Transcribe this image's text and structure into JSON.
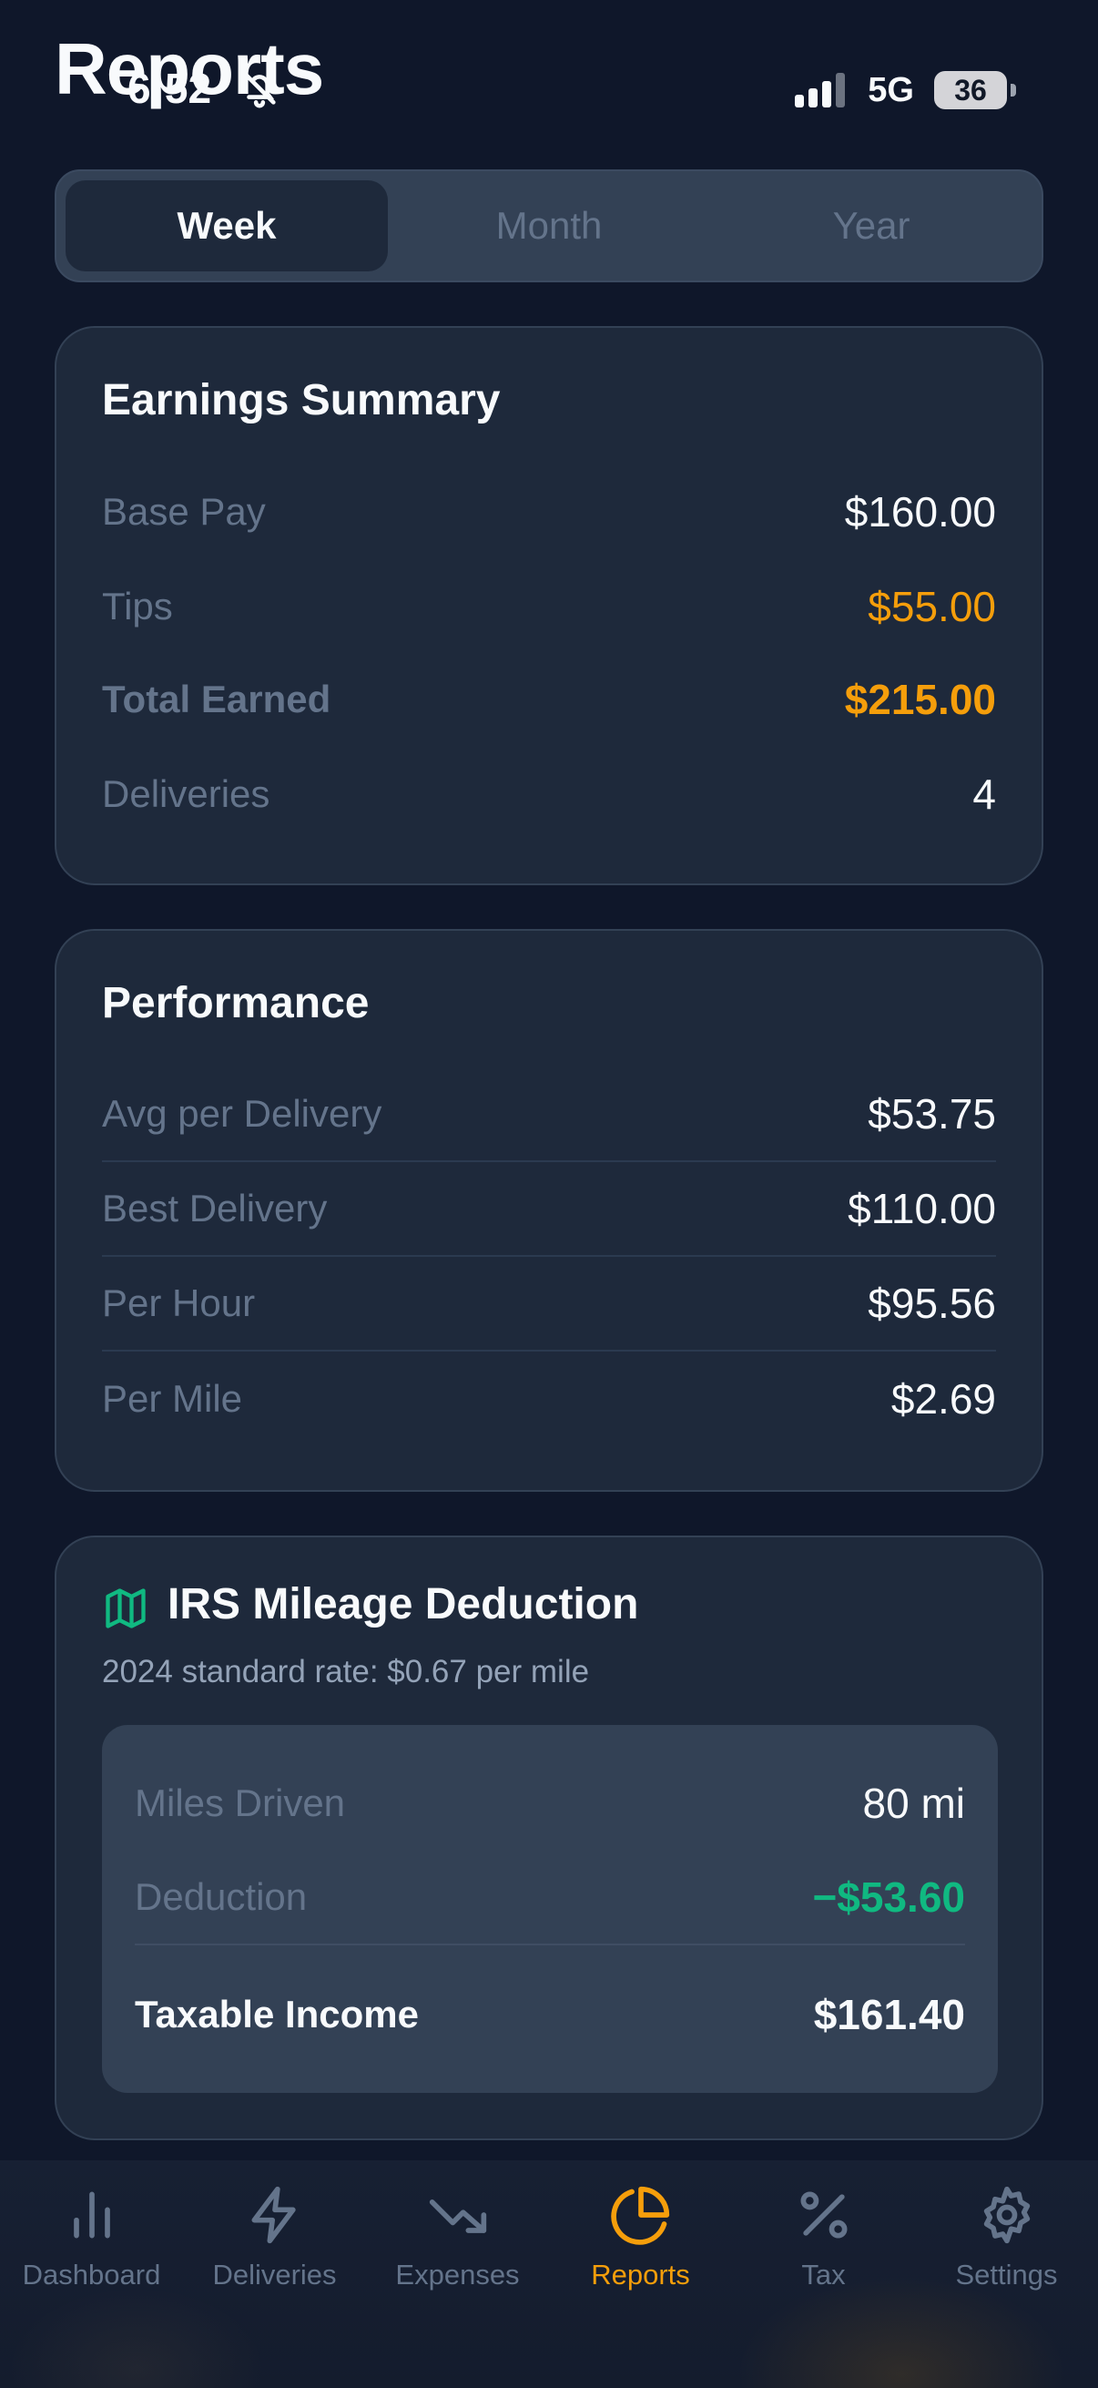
{
  "status_bar": {
    "time": "6:52",
    "network": "5G",
    "battery": "36"
  },
  "header": {
    "title": "Reports"
  },
  "period_tabs": [
    {
      "label": "Week",
      "active": true
    },
    {
      "label": "Month",
      "active": false
    },
    {
      "label": "Year",
      "active": false
    }
  ],
  "earnings_summary": {
    "title": "Earnings Summary",
    "rows": [
      {
        "label": "Base Pay",
        "value": "$160.00"
      },
      {
        "label": "Tips",
        "value": "$55.00"
      },
      {
        "label": "Total Earned",
        "value": "$215.00"
      },
      {
        "label": "Deliveries",
        "value": "4"
      }
    ]
  },
  "performance": {
    "title": "Performance",
    "rows": [
      {
        "label": "Avg per Delivery",
        "value": "$53.75"
      },
      {
        "label": "Best Delivery",
        "value": "$110.00"
      },
      {
        "label": "Per Hour",
        "value": "$95.56"
      },
      {
        "label": "Per Mile",
        "value": "$2.69"
      }
    ]
  },
  "irs_mileage": {
    "title": "IRS Mileage Deduction",
    "subtitle": "2024 standard rate: $0.67 per mile",
    "icon": "map-icon",
    "rows": [
      {
        "label": "Miles Driven",
        "value": "80 mi"
      },
      {
        "label": "Deduction",
        "value": "−$53.60"
      },
      {
        "label": "Taxable Income",
        "value": "$161.40"
      }
    ]
  },
  "bottom_nav": [
    {
      "label": "Dashboard",
      "icon": "bar-chart-icon",
      "active": false
    },
    {
      "label": "Deliveries",
      "icon": "lightning-icon",
      "active": false
    },
    {
      "label": "Expenses",
      "icon": "trending-down-icon",
      "active": false
    },
    {
      "label": "Reports",
      "icon": "pie-chart-icon",
      "active": true
    },
    {
      "label": "Tax",
      "icon": "percent-icon",
      "active": false
    },
    {
      "label": "Settings",
      "icon": "gear-icon",
      "active": false
    }
  ],
  "colors": {
    "background": "#0f172a",
    "card": "#1e293b",
    "accent": "#f59e0b",
    "positive": "#10b981",
    "muted": "#64748b"
  }
}
